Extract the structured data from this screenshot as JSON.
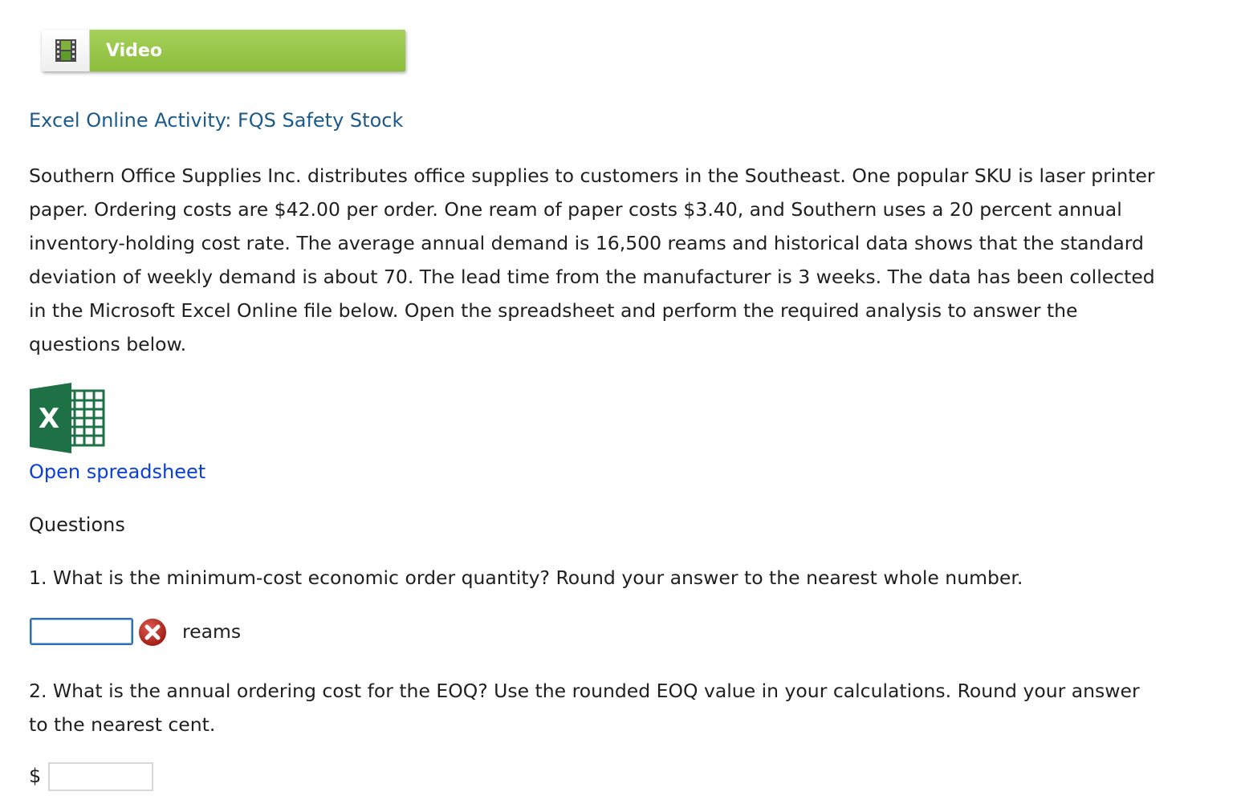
{
  "video_button": {
    "label": "Video",
    "icon": "film-icon",
    "colors": {
      "green": "#96c548",
      "icon_bg": "#f4f4f4"
    }
  },
  "activity": {
    "title": "Excel Online Activity: FQS Safety Stock",
    "title_color": "#1c5a8a"
  },
  "problem": {
    "lines": [
      "Southern Office Supplies Inc. distributes office supplies to customers in the Southeast. One popular SKU is laser printer",
      "paper. Ordering costs are $42.00 per order. One ream of paper costs $3.40, and Southern uses a 20 percent annual",
      "inventory-holding cost rate. The average annual demand is 16,500 reams and historical data shows that the standard",
      "deviation of weekly demand is about 70. The lead time from the manufacturer is 3 weeks. The data has been collected",
      "in the Microsoft Excel Online file below. Open the spreadsheet and perform the required analysis to answer the",
      "questions below."
    ]
  },
  "spreadsheet": {
    "icon": "excel-icon",
    "link_text": "Open spreadsheet",
    "link_color": "#0a3fd6"
  },
  "questions": {
    "heading": "Questions",
    "q1": {
      "text": "1. What is the minimum-cost economic order quantity? Round your answer to the nearest whole number.",
      "value": "",
      "status_icon": "incorrect-x-icon",
      "unit": "reams"
    },
    "q2": {
      "lines": [
        "2. What is the annual ordering cost for the EOQ? Use the rounded EOQ value in your calculations. Round your answer",
        "to the nearest cent."
      ],
      "prefix": "$",
      "value": ""
    }
  }
}
